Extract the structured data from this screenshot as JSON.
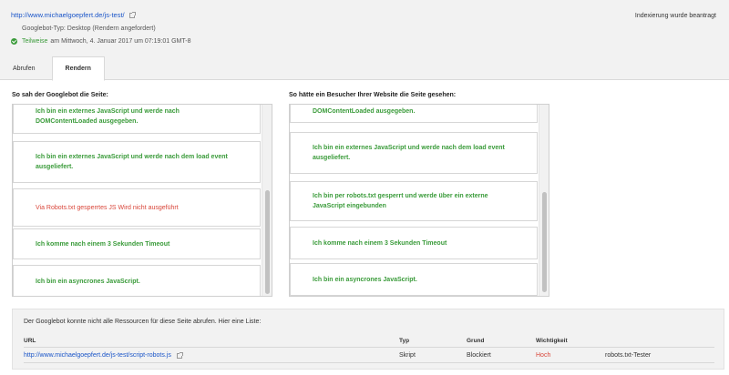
{
  "header": {
    "url": "http://www.michaelgoepfert.de/js-test/",
    "bot_type": "Googlebot-Typ: Desktop (Rendern angefordert)",
    "status_label": "Teilweise",
    "status_detail": "am Mittwoch, 4. Januar 2017 um 07:19:01 GMT-8",
    "index_status": "Indexierung wurde beantragt"
  },
  "tabs": [
    {
      "label": "Abrufen",
      "active": false
    },
    {
      "label": "Rendern",
      "active": true
    }
  ],
  "left_pane": {
    "title": "So sah der Googlebot die Seite:",
    "blocks": [
      {
        "text": "Ich bin ein externes JavaScript und werde nach DOMContentLoaded ausgegeben."
      },
      {
        "text": "Ich bin ein externes JavaScript und werde nach dem load event ausgeliefert."
      },
      {
        "text": "Via Robots.txt gesperrtes JS Wird nicht ausgeführt"
      },
      {
        "text": "Ich komme nach einem 3 Sekunden Timeout"
      },
      {
        "text": "Ich bin ein asyncrones JavaScript."
      }
    ]
  },
  "right_pane": {
    "title": "So hätte ein Besucher Ihrer Website die Seite gesehen:",
    "blocks": [
      {
        "text": "DOMContentLoaded ausgegeben."
      },
      {
        "text": "Ich bin ein externes JavaScript und werde nach dem load event ausgeliefert."
      },
      {
        "text": "Ich bin per robots.txt gesperrt und werde über ein externe JavaScript eingebunden"
      },
      {
        "text": "Ich komme nach einem 3 Sekunden Timeout"
      },
      {
        "text": "Ich bin ein asyncrones JavaScript."
      }
    ]
  },
  "resources": {
    "intro": "Der Googlebot konnte nicht alle Ressourcen für diese Seite abrufen. Hier eine Liste:",
    "columns": {
      "url": "URL",
      "type": "Typ",
      "reason": "Grund",
      "importance": "Wichtigkeit"
    },
    "rows": [
      {
        "url": "http://www.michaelgoepfert.de/js-test/script-robots.js",
        "type": "Skript",
        "reason": "Blockiert",
        "importance": "Hoch",
        "action": "robots.txt-Tester"
      }
    ]
  },
  "colors": {
    "link": "#1a55c8",
    "success_green": "#3a9b3a",
    "error_red": "#d9463a"
  }
}
